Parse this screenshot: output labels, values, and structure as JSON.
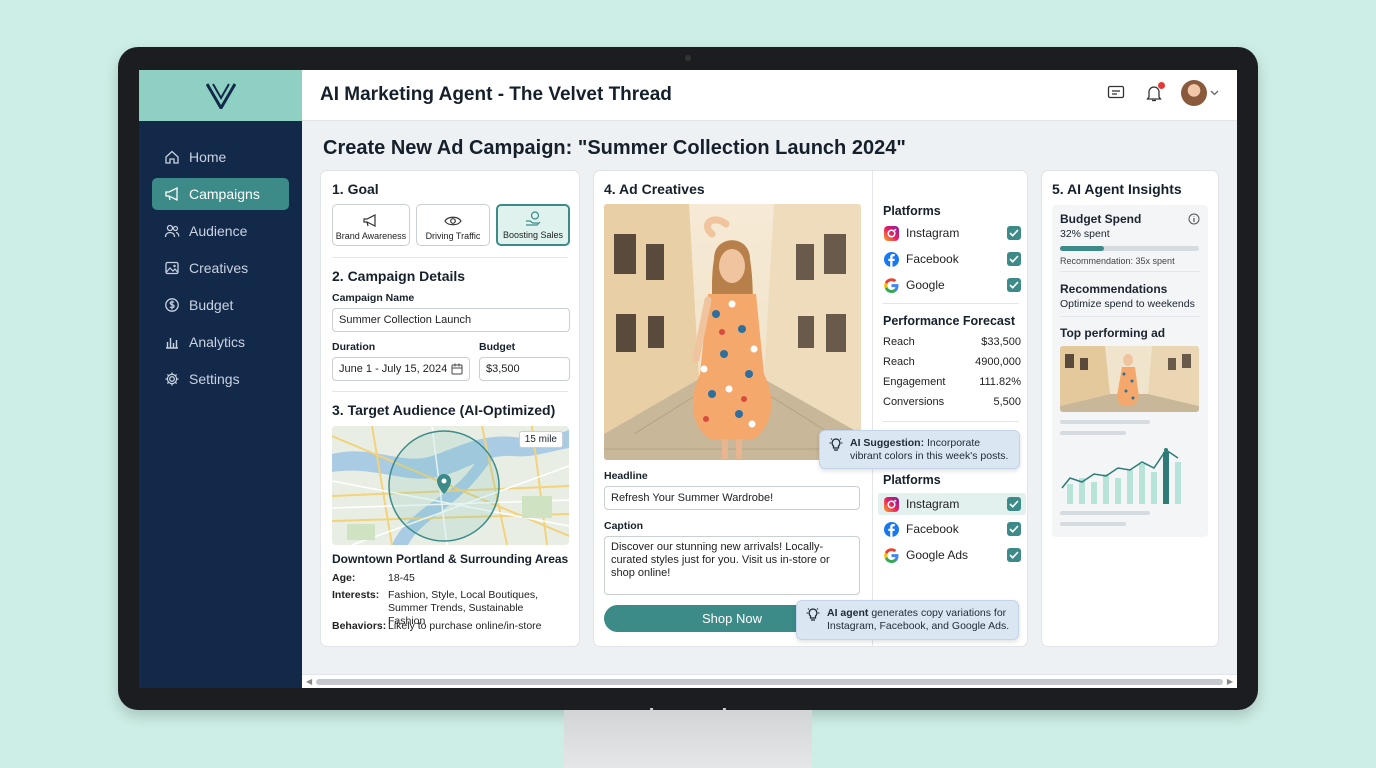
{
  "app": {
    "title": "AI Marketing Agent - The Velvet Thread"
  },
  "nav": [
    {
      "label": "Home",
      "icon": "home-icon"
    },
    {
      "label": "Campaigns",
      "icon": "megaphone-icon",
      "active": true
    },
    {
      "label": "Audience",
      "icon": "users-icon"
    },
    {
      "label": "Creatives",
      "icon": "image-icon"
    },
    {
      "label": "Budget",
      "icon": "dollar-icon"
    },
    {
      "label": "Analytics",
      "icon": "bar-chart-icon"
    },
    {
      "label": "Settings",
      "icon": "gear-icon"
    }
  ],
  "page": {
    "title": "Create New Ad Campaign: \"Summer Collection Launch 2024\""
  },
  "goal": {
    "heading": "1. Goal",
    "options": [
      {
        "label": "Brand Awareness",
        "icon": "megaphone-icon"
      },
      {
        "label": "Driving Traffic",
        "icon": "eye-icon"
      },
      {
        "label": "Boosting Sales",
        "icon": "sales-icon",
        "selected": true
      }
    ]
  },
  "details": {
    "heading": "2. Campaign Details",
    "name_label": "Campaign Name",
    "name_value": "Summer Collection Launch",
    "duration_label": "Duration",
    "duration_value": "June 1 - July 15, 2024",
    "budget_label": "Budget",
    "budget_value": "$3,500"
  },
  "audience": {
    "heading": "3. Target Audience (AI-Optimized)",
    "radius": "15 mile",
    "location": "Downtown Portland & Surrounding Areas",
    "age_label": "Age:",
    "age_value": "18-45",
    "interests_label": "Interests:",
    "interests_value": "Fashion, Style, Local Boutiques, Summer Trends, Sustainable Fashion",
    "behaviors_label": "Behaviors:",
    "behaviors_value": "Likely to purchase online/in-store"
  },
  "creatives": {
    "heading": "4. Ad Creatives",
    "headline_label": "Headline",
    "headline_value": "Refresh Your Summer Wardrobe!",
    "caption_label": "Caption",
    "caption_value": "Discover our stunning new arrivals! Locally-curated styles just for you. Visit us in-store or shop online!",
    "cta": "Shop Now",
    "platforms_heading": "Platforms",
    "platforms": [
      {
        "label": "Instagram",
        "icon": "instagram-icon",
        "checked": true
      },
      {
        "label": "Facebook",
        "icon": "facebook-icon",
        "checked": true
      },
      {
        "label": "Google",
        "icon": "google-icon",
        "checked": true
      }
    ],
    "forecast_heading": "Performance Forecast",
    "forecast": [
      {
        "label": "Reach",
        "value": "$33,500"
      },
      {
        "label": "Reach",
        "value": "4900,000"
      },
      {
        "label": "Engagement",
        "value": "111.82%"
      },
      {
        "label": "Conversions",
        "value": "5,500"
      }
    ],
    "suggestion_bold": "AI Suggestion:",
    "suggestion_text": " Incorporate vibrant colors in this week's posts.",
    "platforms2_heading": "Platforms",
    "platforms2": [
      {
        "label": "Instagram",
        "icon": "instagram-icon",
        "checked": true
      },
      {
        "label": "Facebook",
        "icon": "facebook-icon",
        "checked": true
      },
      {
        "label": "Google Ads",
        "icon": "google-icon",
        "checked": true
      }
    ],
    "agent_bold": "AI agent",
    "agent_text": " generates copy variations for Instagram, Facebook, and Google Ads."
  },
  "insights": {
    "heading": "5. AI Agent Insights",
    "budget_title": "Budget Spend",
    "budget_spent": "32% spent",
    "budget_progress": 0.32,
    "recommendation_small": "Recommendation: 35x spent",
    "rec_title": "Recommendations",
    "rec_text": "Optimize spend to weekends",
    "top_ad": "Top performing ad"
  },
  "colors": {
    "accent": "#3c8b88",
    "sidebar": "#13294a",
    "logo_bg": "#8ed1c3"
  }
}
